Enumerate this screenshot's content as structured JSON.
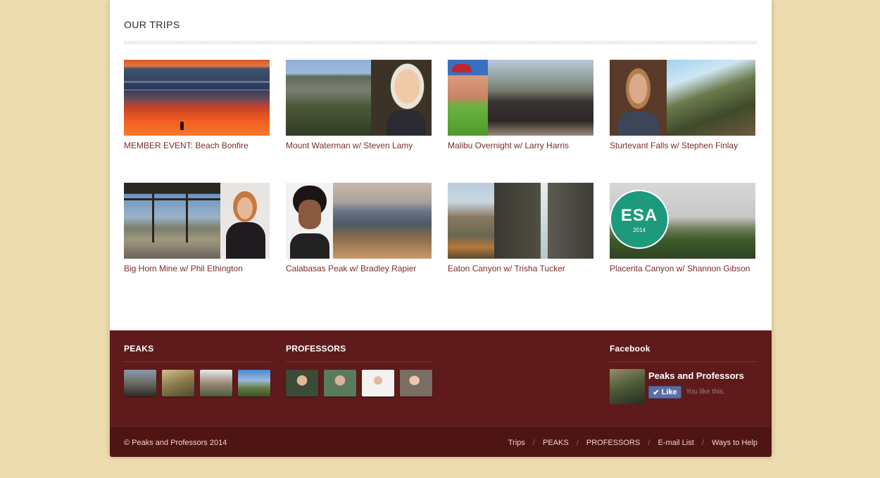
{
  "main": {
    "section_title": "OUR TRIPS",
    "trips": [
      {
        "caption": "MEMBER EVENT: Beach Bonfire"
      },
      {
        "caption": "Mount Waterman w/ Steven Lamy"
      },
      {
        "caption": "Malibu Overnight w/ Larry Harris"
      },
      {
        "caption": "Sturtevant Falls w/ Stephen Finlay"
      },
      {
        "caption": "Big Horn Mine w/ Phil Ethington"
      },
      {
        "caption": "Calabasas Peak w/ Bradley Rapier"
      },
      {
        "caption": "Eaton Canyon w/ Trisha Tucker"
      },
      {
        "caption": "Placerita Canyon w/ Shannon Gibson"
      }
    ]
  },
  "footer": {
    "peaks_heading": "PEAKS",
    "professors_heading": "PROFESSORS",
    "facebook_heading": "Facebook",
    "facebook": {
      "page_name": "Peaks and Professors",
      "like_label": "Like",
      "like_status": "You like this."
    },
    "esa_badge": "ESA",
    "esa_year": "2014"
  },
  "bottom": {
    "copyright": "© Peaks and Professors 2014",
    "nav": [
      "Trips",
      "PEAKS",
      "PROFESSORS",
      "E-mail List",
      "Ways to Help"
    ]
  },
  "colors": {
    "page_background": "#ecdcb0",
    "footer_background": "#5f1b1b",
    "caption_text": "#7b2b2b"
  }
}
